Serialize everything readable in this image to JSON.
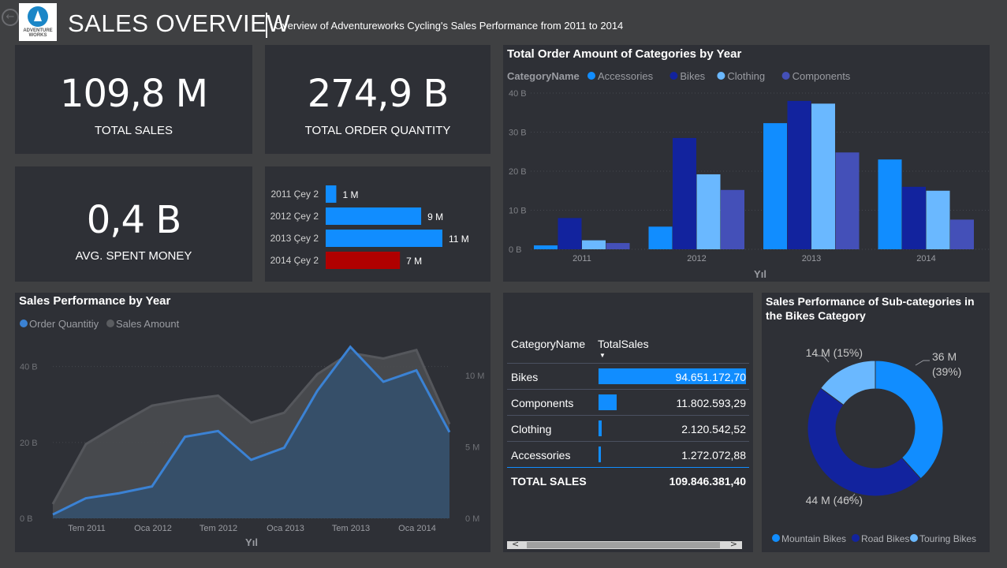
{
  "header": {
    "title": "SALES OVERVIEW",
    "subtitle": "Overview of Adventureworks Cycling's Sales Performance from 2011 to 2014",
    "logo_text": "ADVENTURE WORKS",
    "back_icon": "back-arrow-icon"
  },
  "kpis": {
    "total_sales": {
      "value": "109,8 M",
      "label": "TOTAL SALES"
    },
    "total_order_quantity": {
      "value": "274,9 B",
      "label": "TOTAL ORDER QUANTITY"
    },
    "avg_spent_money": {
      "value": "0,4 B",
      "label": "AVG. SPENT MONEY"
    }
  },
  "colors": {
    "accessories": "#118dff",
    "bikes": "#12239e",
    "clothing": "#6ab8ff",
    "components": "#4450b8",
    "negative": "#b00000",
    "area_order": "#3b82d4",
    "area_sales": "#4a4c50",
    "card_bg": "#2e3036",
    "page_bg": "#3f4042"
  },
  "chart_data": [
    {
      "id": "quarter_bars",
      "type": "bar",
      "orientation": "horizontal",
      "categories": [
        "2011 Çey 2",
        "2012 Çey 2",
        "2013 Çey 2",
        "2014 Çey 2"
      ],
      "values": [
        1,
        9,
        11,
        7
      ],
      "data_labels": [
        "1 M",
        "9 M",
        "11 M",
        "7 M"
      ],
      "highlight_index": 3,
      "xlim": [
        0,
        11
      ]
    },
    {
      "id": "categories_by_year",
      "type": "bar",
      "title": "Total Order Amount of Categories by Year",
      "legend_title": "CategoryName",
      "legend_position": "top-left",
      "categories": [
        "2011",
        "2012",
        "2013",
        "2014"
      ],
      "xlabel": "Yıl",
      "ylim": [
        0,
        40
      ],
      "y_ticks": [
        "0 B",
        "10 B",
        "20 B",
        "30 B",
        "40 B"
      ],
      "grid": true,
      "series": [
        {
          "name": "Accessories",
          "values": [
            1,
            5.8,
            32.3,
            23
          ]
        },
        {
          "name": "Bikes",
          "values": [
            8,
            28.5,
            38,
            16
          ]
        },
        {
          "name": "Clothing",
          "values": [
            2.3,
            19.2,
            37.3,
            15
          ]
        },
        {
          "name": "Components",
          "values": [
            1.6,
            15.2,
            24.8,
            7.6
          ]
        }
      ]
    },
    {
      "id": "sales_performance",
      "type": "area",
      "title": "Sales Performance by Year",
      "legend_position": "top-left",
      "xlabel": "Yıl",
      "x_ticks": [
        "Tem 2011",
        "Oca 2012",
        "Tem 2012",
        "Oca 2013",
        "Tem 2013",
        "Oca 2014"
      ],
      "y_left_ticks": [
        "0 B",
        "20 B",
        "40 B"
      ],
      "y_left_lim": [
        0,
        47
      ],
      "y_right_ticks": [
        "0 M",
        "5 M",
        "10 M"
      ],
      "y_right_lim": [
        0,
        12.5
      ],
      "series": [
        {
          "name": "Order Quantitiy",
          "axis": "left",
          "values": [
            1,
            5.3,
            6.6,
            8.4,
            21.5,
            23,
            15.4,
            18.6,
            33.6,
            45.2,
            36,
            39,
            22.7
          ]
        },
        {
          "name": "Sales Amount",
          "axis": "right",
          "values": [
            1,
            5.2,
            6.6,
            7.9,
            8.3,
            8.6,
            6.7,
            7.4,
            10.1,
            11.6,
            11.2,
            11.8,
            6.6
          ]
        }
      ]
    },
    {
      "id": "bikes_subcategories",
      "type": "pie",
      "style": "donut",
      "title": "Sales Performance of Sub-categories in the Bikes Category",
      "legend_position": "bottom",
      "slices": [
        {
          "name": "Mountain Bikes",
          "value": 36,
          "label": "36 M (39%)"
        },
        {
          "name": "Road Bikes",
          "value": 44,
          "label": "44 M (46%)"
        },
        {
          "name": "Touring Bikes",
          "value": 14,
          "label": "14 M (15%)"
        }
      ]
    },
    {
      "id": "category_table",
      "type": "table",
      "columns": [
        "CategoryName",
        "TotalSales"
      ],
      "rows": [
        {
          "name": "Bikes",
          "value": "94.651.172,70",
          "numeric": 94651172.7
        },
        {
          "name": "Components",
          "value": "11.802.593,29",
          "numeric": 11802593.29
        },
        {
          "name": "Clothing",
          "value": "2.120.542,52",
          "numeric": 2120542.52
        },
        {
          "name": "Accessories",
          "value": "1.272.072,88",
          "numeric": 1272072.88
        }
      ],
      "total": {
        "label": "TOTAL SALES",
        "value": "109.846.381,40"
      }
    }
  ]
}
